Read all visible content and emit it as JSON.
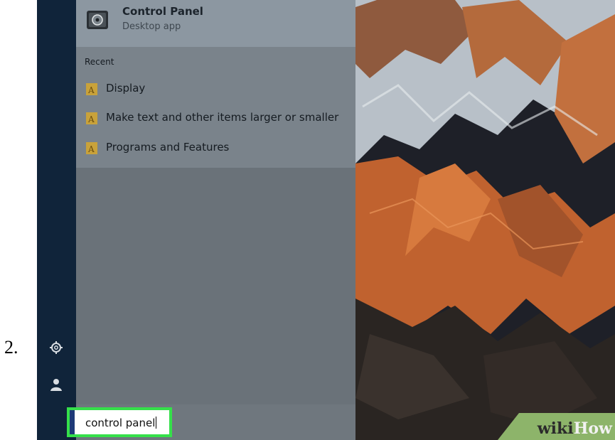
{
  "step_number": "2.",
  "best_match": {
    "name": "Control Panel",
    "type": "Desktop app",
    "icon": "control-panel-icon"
  },
  "recent": {
    "title": "Recent",
    "items": [
      {
        "label": "Display",
        "icon": "settings-page-icon"
      },
      {
        "label": "Make text and other items larger or smaller",
        "icon": "settings-page-icon"
      },
      {
        "label": "Programs and Features",
        "icon": "settings-page-icon"
      }
    ]
  },
  "search": {
    "value": "control panel"
  },
  "rail": {
    "icons": [
      "gear-icon",
      "user-icon"
    ]
  },
  "watermark": {
    "part1": "wiki",
    "part2": "How"
  },
  "colors": {
    "highlight": "#35e04a",
    "rail": "#10243a",
    "panel": "#6a7279",
    "best_match_bg": "#8c97a1"
  }
}
